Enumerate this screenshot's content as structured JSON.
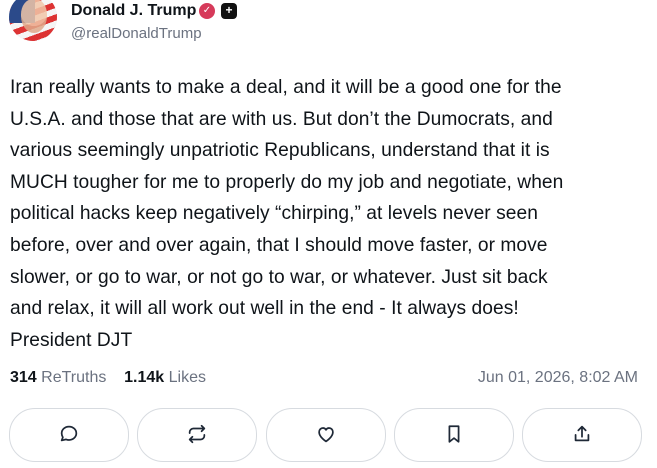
{
  "author": {
    "name": "Donald J. Trump",
    "handle": "@realDonaldTrump"
  },
  "post": {
    "lines": [
      "Iran really wants to make a deal, and it will be a good one for the",
      "U.S.A. and those that are with us. But don’t the Dumocrats, and",
      "various seemingly unpatriotic Republicans,  understand that it is",
      "MUCH tougher for me to properly do my job and negotiate, when",
      "political hacks keep negatively “chirping,” at levels never seen",
      "before, over and over again, that I should move faster, or move",
      "slower, or go to war, or not go to war, or whatever. Just sit back",
      "and relax, it will all work out well in the end - It always does!",
      "President DJT"
    ]
  },
  "stats": {
    "retruths_count": "314",
    "retruths_label": "ReTruths",
    "likes_count": "1.14k",
    "likes_label": "Likes"
  },
  "timestamp": "Jun 01, 2026, 8:02 AM",
  "actions": [
    "reply-icon",
    "retruth-icon",
    "like-icon",
    "bookmark-icon",
    "share-icon"
  ]
}
